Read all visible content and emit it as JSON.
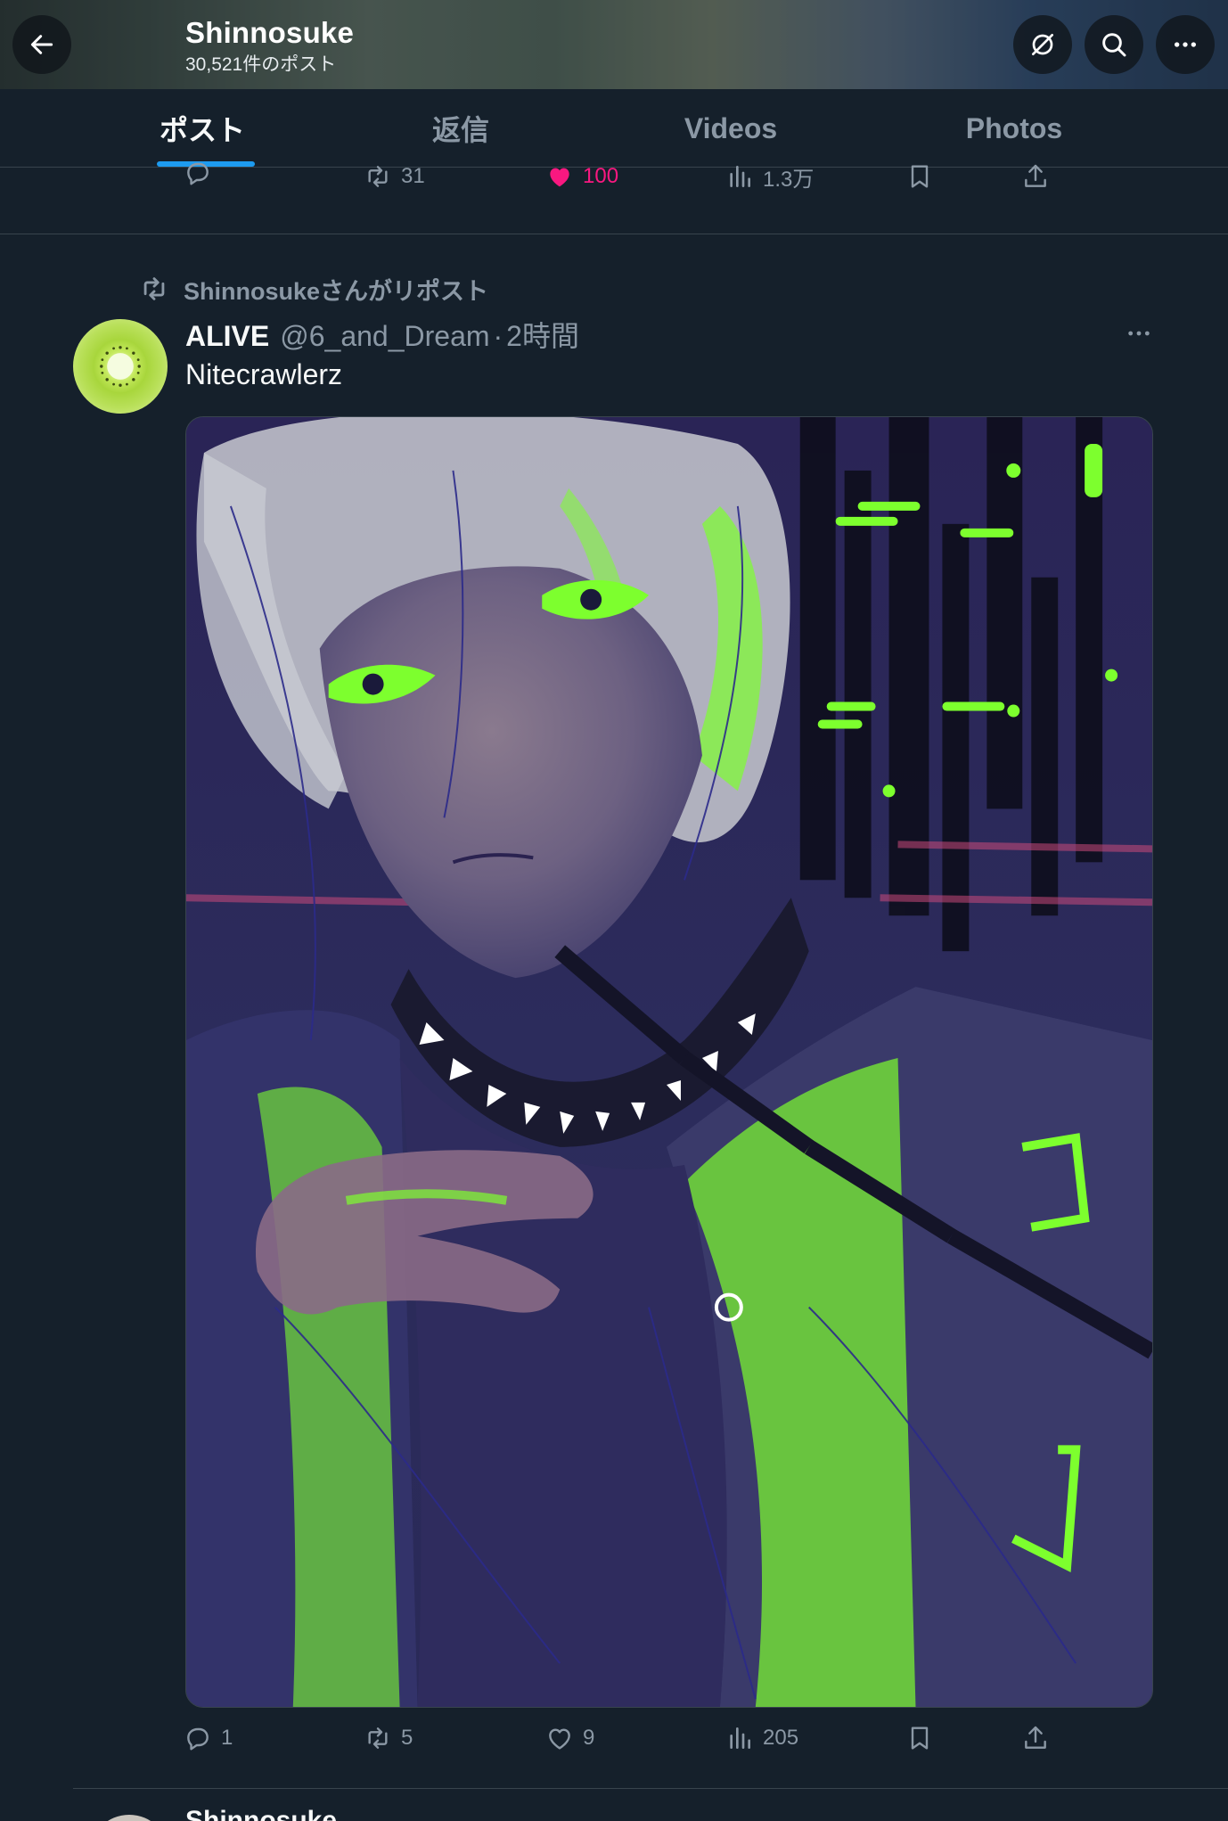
{
  "header": {
    "title": "Shinnosuke",
    "post_count": "30,521件のポスト"
  },
  "tabs": [
    {
      "label": "ポスト",
      "active": true
    },
    {
      "label": "返信",
      "active": false
    },
    {
      "label": "Videos",
      "active": false
    },
    {
      "label": "Photos",
      "active": false
    }
  ],
  "prev_tweet": {
    "actions": {
      "reply": "",
      "retweet": "31",
      "like": "100",
      "views": "1.3万"
    }
  },
  "retweet_context": "Shinnosukeさんがリポスト",
  "tweet": {
    "name": "ALIVE",
    "handle": "@6_and_Dream",
    "dot": "·",
    "time": "2時間",
    "text": "Nitecrawlerz",
    "actions": {
      "reply": "1",
      "retweet": "5",
      "like": "9",
      "views": "205"
    }
  },
  "next_tweet": {
    "name": "Shinnosuke"
  },
  "colors": {
    "background": "#15202b",
    "accent": "#1d9bf0",
    "like": "#f91880",
    "muted": "#8b98a5",
    "artwork_green": "#7dff2e",
    "artwork_purple": "#2b2a55"
  },
  "icons": [
    "back-arrow-icon",
    "no-sync-icon",
    "search-icon",
    "more-icon",
    "reply-icon",
    "retweet-icon",
    "heart-icon",
    "views-icon",
    "bookmark-icon",
    "share-icon"
  ]
}
